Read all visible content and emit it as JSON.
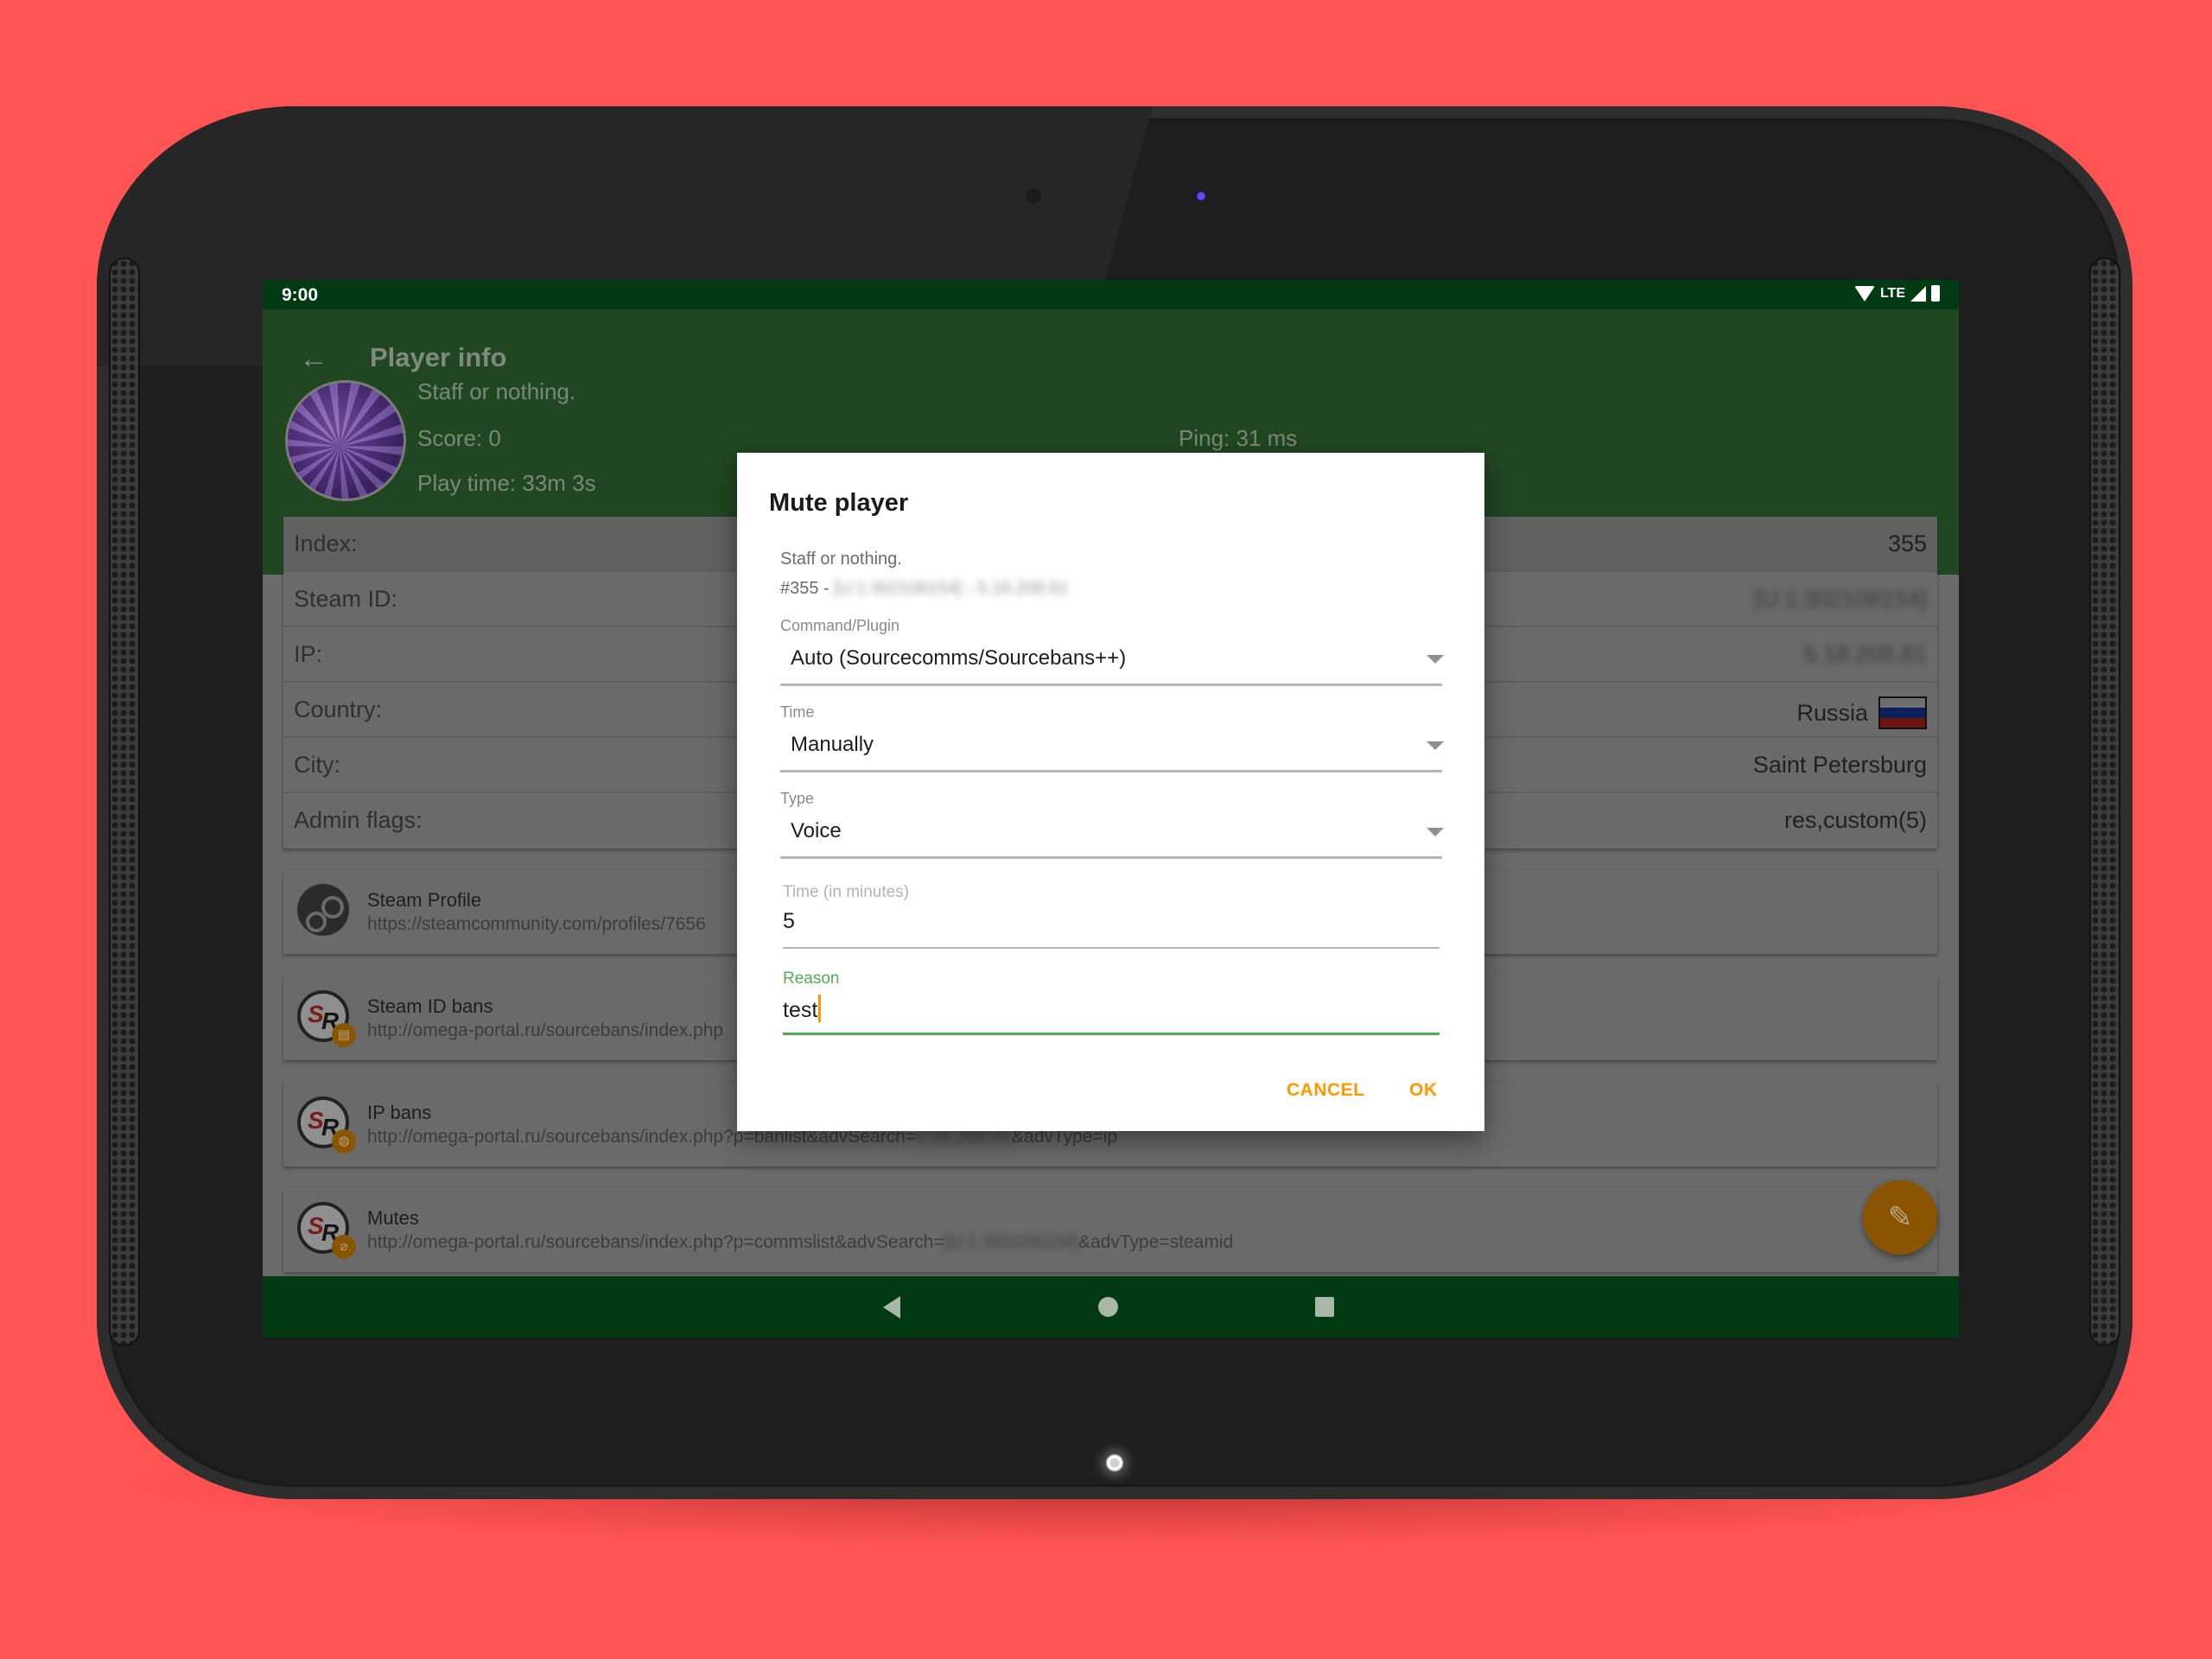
{
  "colors": {
    "background": "#fe5454",
    "statusbar": "#003912",
    "header": "#214722",
    "accent": "#ff9800",
    "focus": "#4caf50",
    "fab": "#8a5400"
  },
  "statusbar": {
    "time": "9:00",
    "network_label": "LTE",
    "icons": [
      "wifi-icon",
      "lte-signal-icon",
      "battery-icon"
    ]
  },
  "header": {
    "back_icon": "arrow-back-icon",
    "back_glyph": "←",
    "title": "Player info",
    "player_name": "Staff or nothing.",
    "score": "Score: 0",
    "play_time": "Play time: 33m 3s",
    "ping": "Ping: 31 ms"
  },
  "info": {
    "rows": [
      {
        "label": "Index:",
        "value": "355"
      },
      {
        "label": "Steam ID:",
        "value": "[U:1:302106154]"
      },
      {
        "label": "IP:",
        "value": "5.18.208.81"
      },
      {
        "label": "Country:",
        "value": "Russia"
      },
      {
        "label": "City:",
        "value": "Saint Petersburg"
      },
      {
        "label": "Admin flags:",
        "value": "res,custom(5)"
      }
    ]
  },
  "links": [
    {
      "title": "Steam Profile",
      "url_prefix": "https://steamcommunity.com/profiles/7656",
      "url_hidden": "",
      "url_suffix": "",
      "icon": "steam-icon",
      "badge": ""
    },
    {
      "title": "Steam ID bans",
      "url_prefix": "http://omega-portal.ru/sourcebans/index.php",
      "url_hidden": "",
      "url_suffix": "",
      "icon": "sourcebans-icon",
      "badge": "id-card-icon"
    },
    {
      "title": "IP bans",
      "url_prefix": "http://omega-portal.ru/sourcebans/index.php?p=banlist&advSearch=",
      "url_hidden": "5.18.208.81",
      "url_suffix": "&advType=ip",
      "icon": "sourcebans-icon",
      "badge": "globe-icon"
    },
    {
      "title": "Mutes",
      "url_prefix": "http://omega-portal.ru/sourcebans/index.php?p=commslist&advSearch=",
      "url_hidden": "[U:1:302106154]",
      "url_suffix": "&advType=steamid",
      "icon": "sourcebans-icon",
      "badge": "mic-off-icon"
    }
  ],
  "fab": {
    "icon": "person-edit-icon",
    "glyph": "✎"
  },
  "navbar": {
    "back": "nav-back-icon",
    "home": "nav-home-icon",
    "recents": "nav-recents-icon"
  },
  "dialog": {
    "title": "Mute player",
    "player_name": "Staff or nothing.",
    "player_id_prefix": "#355 - ",
    "player_id_hidden": "[U:1:302106154] - 5.18.208.81",
    "fields": {
      "command": {
        "label": "Command/Plugin",
        "value": "Auto (Sourcecomms/Sourcebans++)"
      },
      "time": {
        "label": "Time",
        "value": "Manually"
      },
      "type": {
        "label": "Type",
        "value": "Voice"
      },
      "minutes": {
        "label": "Time (in minutes)",
        "value": "5"
      },
      "reason": {
        "label": "Reason",
        "value": "test"
      }
    },
    "cancel_label": "CANCEL",
    "ok_label": "OK"
  }
}
